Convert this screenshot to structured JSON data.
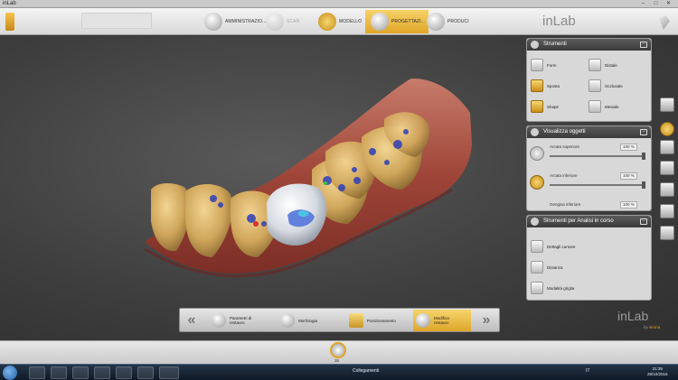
{
  "window": {
    "title": "inLab",
    "minimize": "–",
    "maximize": "□",
    "close": "✕"
  },
  "topbar": {
    "steps": [
      {
        "label": "AMMINISTRAZIO...",
        "state": "done"
      },
      {
        "label": "SCAN",
        "state": "disabled"
      },
      {
        "label": "MODELLO",
        "state": "done"
      },
      {
        "label": "PROGETTAZI...",
        "state": "active"
      },
      {
        "label": "PRODUCI",
        "state": "todo"
      }
    ],
    "brand": "inLab"
  },
  "panels": {
    "tools": {
      "title": "Strumenti",
      "items": [
        {
          "label": "Form",
          "icon": "form-icon"
        },
        {
          "label": "Distale",
          "icon": "distal-icon"
        },
        {
          "label": "Sposta",
          "icon": "move-icon"
        },
        {
          "label": "Occlusale",
          "icon": "occlusal-icon"
        },
        {
          "label": "Shape",
          "icon": "shape-icon"
        },
        {
          "label": "Mesiale",
          "icon": "mesial-icon"
        }
      ]
    },
    "view_objects": {
      "title": "Visualizza oggetti",
      "rows": [
        {
          "label": "Arcata superiore",
          "value": "100 %",
          "level": 1.0
        },
        {
          "label": "Arcata inferiore",
          "value": "100 %",
          "level": 1.0
        },
        {
          "label": "Gengiva inferiore",
          "value": "100 %",
          "level": 1.0
        }
      ]
    },
    "analysis": {
      "title": "Strumenti per Analisi in corso",
      "items": [
        {
          "label": "Dettagli cursore"
        },
        {
          "label": "Distanza"
        },
        {
          "label": "Modalità griglia"
        }
      ]
    }
  },
  "stagebar": {
    "prev": "«",
    "next": "»",
    "stages": [
      {
        "label": "Parametri di restauro",
        "state": "todo"
      },
      {
        "label": "Morfologia",
        "state": "todo"
      },
      {
        "label": "Posizionamento",
        "state": "todo"
      },
      {
        "label": "Modifica restauro",
        "state": "active"
      }
    ]
  },
  "brand_bottom": {
    "name": "inLab",
    "by": "by",
    "maker": "sirona"
  },
  "bottom_strip": {
    "tooth_number": "36"
  },
  "taskbar": {
    "center_label": "Collegamenti",
    "lang": "IT",
    "time": "21:39",
    "date": "28/10/2015"
  },
  "colors": {
    "accent": "#e3a524",
    "panel_head": "#4a4a4a"
  }
}
